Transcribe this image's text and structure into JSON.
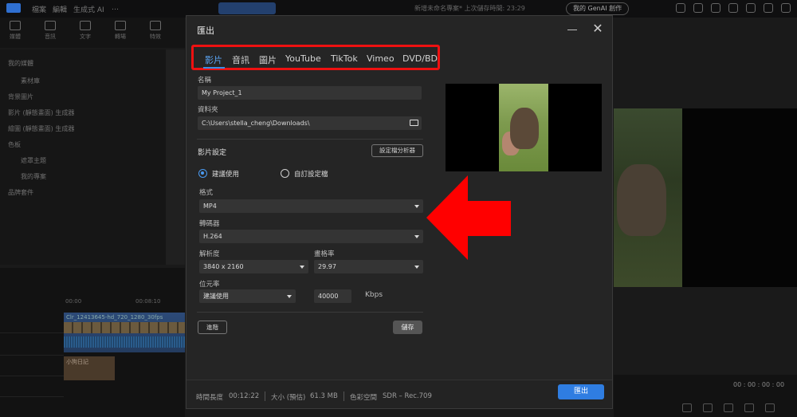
{
  "background": {
    "menu": [
      "檔案",
      "編輯",
      "生成式 AI",
      "…"
    ],
    "project_title": "新增未命名專案* 上次儲存時間: 23:29",
    "genai_button": "我的 GenAI 創作",
    "tools": [
      "媒體",
      "音訊",
      "文字",
      "轉場",
      "特效"
    ],
    "library": [
      "我的媒體",
      "素材庫",
      "背景圖片",
      "影片 (靜態畫面) 生成器",
      "繪圖 (靜態畫面) 生成器",
      "色板",
      "遮罩主題",
      "我的專案",
      "品牌套件"
    ],
    "timecodes": [
      "00:00",
      "00:08:10"
    ],
    "clip_video": "Clr_12413645-hd_720_1280_30fps",
    "clip_title": "小狗日記",
    "preview_timecode": "00 : 00 : 00 : 00"
  },
  "dialog": {
    "title": "匯出",
    "tabs": [
      "影片",
      "音訊",
      "圖片",
      "YouTube",
      "TikTok",
      "Vimeo",
      "DVD/BD"
    ],
    "active_tab": 0,
    "name_label": "名稱",
    "name_value": "My Project_1",
    "folder_label": "資料夾",
    "folder_value": "C:\\Users\\stella_cheng\\Downloads\\",
    "video_settings_title": "影片設定",
    "profile_analyzer_button": "設定檔分析器",
    "radio_recommended": "建議使用",
    "radio_custom": "自訂設定檔",
    "format_label": "格式",
    "format_value": "MP4",
    "codec_label": "轉碼器",
    "codec_value": "H.264",
    "resolution_label": "解析度",
    "resolution_value": "3840 x 2160",
    "framerate_label": "畫格率",
    "framerate_value": "29.97",
    "bitrate_label": "位元率",
    "bitrate_mode": "建議使用",
    "bitrate_value": "40000",
    "bitrate_unit": "Kbps",
    "advanced_button": "進階",
    "save_button": "儲存",
    "footer": {
      "duration_label": "時間長度",
      "duration_value": "00:12:22",
      "size_label": "大小 (預估)",
      "size_value": "61.3 MB",
      "colorspace_label": "色彩空間",
      "colorspace_value": "SDR – Rec.709"
    },
    "export_button": "匯出"
  },
  "colors": {
    "highlight_box": "#e11111",
    "accent": "#2f7de1",
    "arrow": "#ff0000"
  }
}
